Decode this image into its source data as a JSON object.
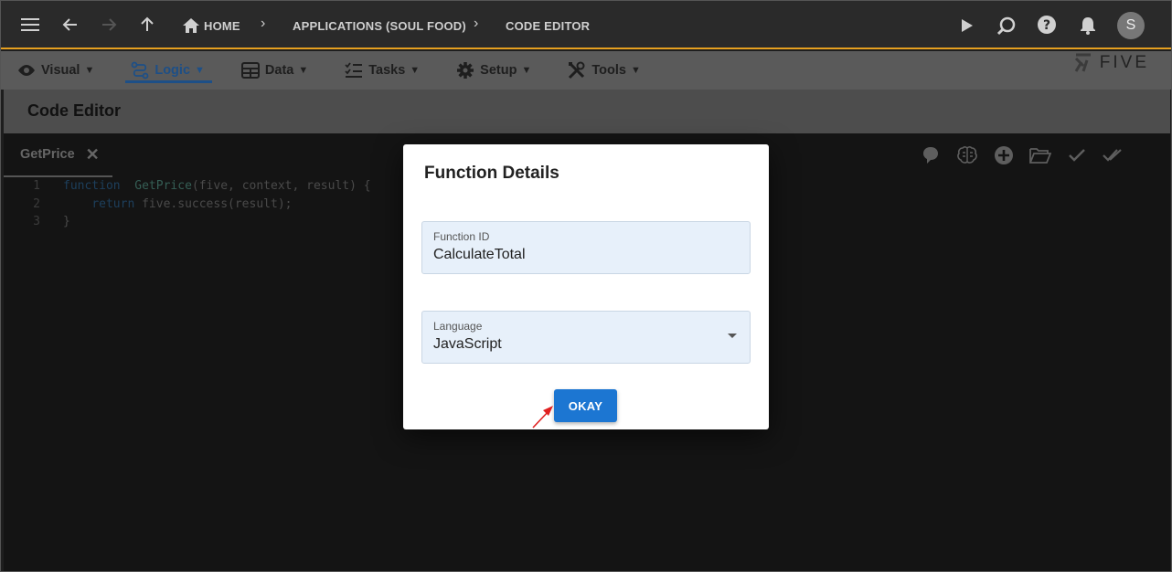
{
  "topbar": {
    "breadcrumbs": [
      "HOME",
      "APPLICATIONS (SOUL FOOD)",
      "CODE EDITOR"
    ],
    "avatar_initial": "S",
    "icons": [
      "menu-icon",
      "back-arrow-icon",
      "forward-arrow-icon",
      "up-arrow-icon",
      "home-icon",
      "play-icon",
      "search-icon",
      "help-icon",
      "bell-icon"
    ]
  },
  "menubar": {
    "items": [
      {
        "label": "Visual",
        "icon": "eye-icon"
      },
      {
        "label": "Logic",
        "icon": "logic-icon",
        "active": true
      },
      {
        "label": "Data",
        "icon": "table-icon"
      },
      {
        "label": "Tasks",
        "icon": "tasks-icon"
      },
      {
        "label": "Setup",
        "icon": "gear-icon"
      },
      {
        "label": "Tools",
        "icon": "tools-icon"
      }
    ],
    "caret": "▼",
    "logo_text": "FIVE"
  },
  "header": {
    "title": "Code Editor"
  },
  "editor": {
    "tab_label": "GetPrice",
    "code_lines": [
      {
        "num": "1",
        "parts": [
          [
            "kw",
            "function"
          ],
          [
            "",
            "  "
          ],
          [
            "fn",
            "GetPrice"
          ],
          [
            "",
            "(five, context, result) {"
          ]
        ]
      },
      {
        "num": "2",
        "parts": [
          [
            "",
            "    "
          ],
          [
            "kw",
            "return"
          ],
          [
            "",
            " five.success(result);"
          ]
        ]
      },
      {
        "num": "3",
        "parts": [
          [
            "",
            "}"
          ]
        ]
      }
    ],
    "toolbar_icons": [
      "help-bubble-icon",
      "brain-icon",
      "add-circle-icon",
      "folder-open-icon",
      "check-icon",
      "double-check-icon"
    ]
  },
  "dialog": {
    "title": "Function Details",
    "function_id": {
      "label": "Function ID",
      "value": "CalculateTotal"
    },
    "language": {
      "label": "Language",
      "value": "JavaScript"
    },
    "okay_label": "OKAY"
  },
  "colors": {
    "accent": "#e6a020",
    "primary_button": "#1c76d2",
    "field_background": "#e7f0fa",
    "annotation_arrow": "#e02020"
  }
}
